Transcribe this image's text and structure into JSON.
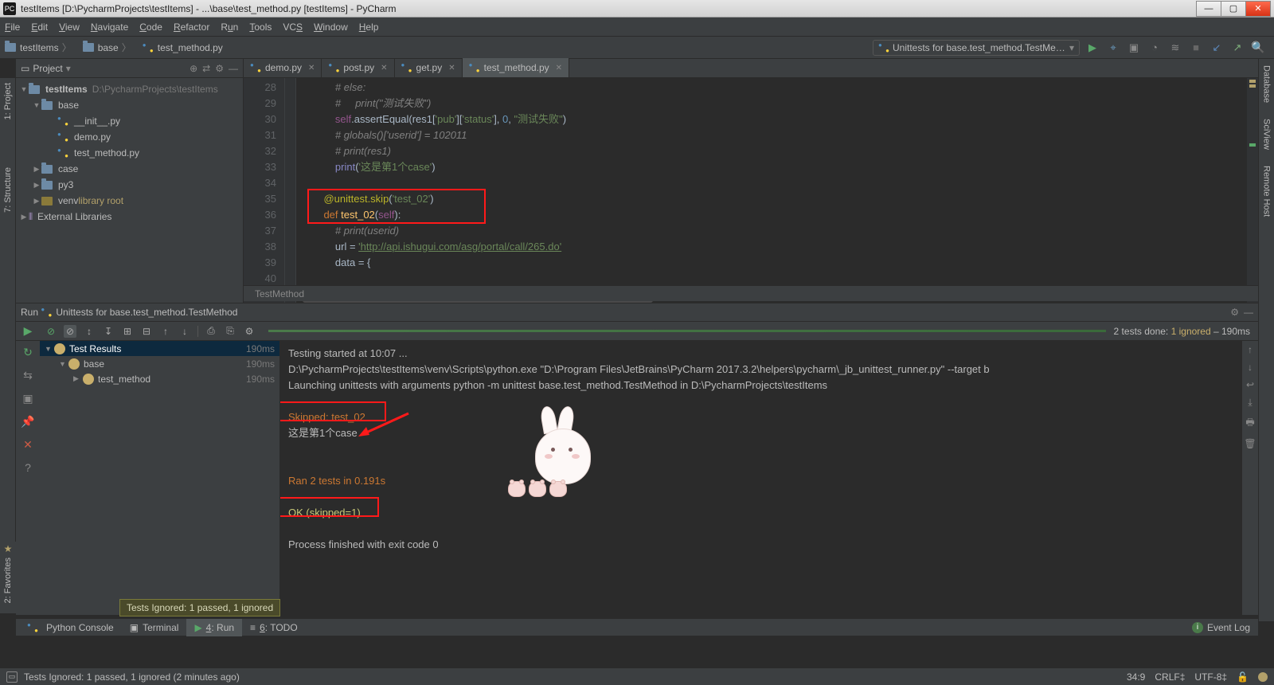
{
  "title": "testItems [D:\\PycharmProjects\\testItems] - ...\\base\\test_method.py [testItems] - PyCharm",
  "menus": [
    "File",
    "Edit",
    "View",
    "Navigate",
    "Code",
    "Refactor",
    "Run",
    "Tools",
    "VCS",
    "Window",
    "Help"
  ],
  "crumbs": {
    "a": "testItems",
    "b": "base",
    "c": "test_method.py"
  },
  "run_config": "Unittests for base.test_method.TestMetho...",
  "project": {
    "label": "Project",
    "root": {
      "name": "testItems",
      "path": "D:\\PycharmProjects\\testItems"
    },
    "base": "base",
    "files": {
      "init": "__init__.py",
      "demo": "demo.py",
      "tm": "test_method.py"
    },
    "case": "case",
    "py3": "py3",
    "venv": "venv",
    "venv_tag": "library root",
    "ext": "External Libraries"
  },
  "tabs": {
    "demo": "demo.py",
    "post": "post.py",
    "get": "get.py",
    "tm": "test_method.py"
  },
  "code": {
    "l28": "# else:",
    "l29": "#     print(\"测试失败\")",
    "l30a": "self",
    "l30b": ".assertEqual(res1[",
    "l30c": "'pub'",
    "l30d": "][",
    "l30e": "'status'",
    "l30f": "], ",
    "l30g": "0",
    "l30h": ", ",
    "l30i": "\"测试失败\"",
    "l30j": ")",
    "l31": "# globals()['userid'] = 102011",
    "l32": "# print(res1)",
    "l33a": "print",
    "l33b": "(",
    "l33c": "'这是第1个case'",
    "l33d": ")",
    "l35a": "@unittest.skip",
    "l35b": "(",
    "l35c": "'test_02'",
    "l35d": ")",
    "l36a": "def ",
    "l36b": "test_02",
    "l36c": "(",
    "l36d": "self",
    "l36e": "):",
    "l37": "# print(userid)",
    "l38a": "url = ",
    "l38b": "'http://api.ishugui.com/asg/portal/call/265.do'",
    "l39": "data = {",
    "nums": [
      "28",
      "29",
      "30",
      "31",
      "32",
      "33",
      "34",
      "35",
      "36",
      "37",
      "38",
      "39",
      "40"
    ]
  },
  "crumb_bot": "TestMethod",
  "run_hdr": {
    "label": "Run",
    "cfg": "Unittests for base.test_method.TestMethod"
  },
  "run_sum": {
    "a": "2 tests done: ",
    "b": "1 ignored",
    "c": " – 190ms"
  },
  "testtree": {
    "root": "Test Results",
    "root_t": "190ms",
    "base": "base",
    "base_t": "190ms",
    "tm": "test_method",
    "tm_t": "190ms"
  },
  "console": {
    "l1": "Testing started at 10:07 ...",
    "l2": "D:\\PycharmProjects\\testItems\\venv\\Scripts\\python.exe \"D:\\Program Files\\JetBrains\\PyCharm 2017.3.2\\helpers\\pycharm\\_jb_unittest_runner.py\" --target b",
    "l3": "Launching unittests with arguments python -m unittest base.test_method.TestMethod in D:\\PycharmProjects\\testItems",
    "l5": "Skipped: test_02",
    "l6": "这是第1个case",
    "l8": "Ran 2 tests in 0.191s",
    "l10": "OK (skipped=1)",
    "l12": "Process finished with exit code 0"
  },
  "tooltip": "Tests Ignored: 1 passed, 1 ignored",
  "bottom": {
    "pycon": "Python Console",
    "term": "Terminal",
    "run": "4: Run",
    "todo": "6: TODO",
    "evt": "Event Log"
  },
  "status": {
    "msg": "Tests Ignored: 1 passed, 1 ignored (2 minutes ago)",
    "pos": "34:9",
    "eol": "CRLF‡",
    "enc": "UTF-8‡"
  },
  "rails": {
    "proj": "1: Project",
    "struct": "7: Structure",
    "fav": "2: Favorites",
    "db": "Database",
    "sv": "SciView",
    "rh": "Remote Host"
  }
}
